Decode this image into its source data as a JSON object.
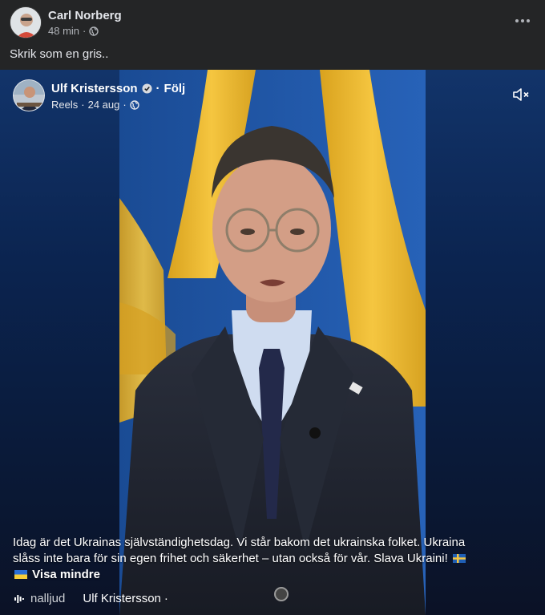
{
  "post": {
    "author": "Carl Norberg",
    "time": "48 min",
    "separator": "·",
    "text": "Skrik som en gris.."
  },
  "reel": {
    "author": "Ulf Kristersson",
    "follow_sep": "·",
    "follow_label": "Följ",
    "meta_type": "Reels",
    "meta_sep": "·",
    "meta_date": "24 aug",
    "meta_sep2": "·",
    "caption_line1": "Idag är det Ukrainas självständighetsdag. Vi står bakom det ukrainska folket. Ukraina",
    "caption_line2": "slåss inte bara för sin egen frihet och säkerhet – utan också för vår. Slava Ukraini!",
    "show_less_label": "Visa mindre",
    "audio_label": "nalljud",
    "audio_artist": "Ulf Kristersson",
    "audio_sep": "·"
  },
  "icons": {
    "more": "more-horizontal-icon",
    "globe": "globe-icon",
    "verified": "verified-badge-icon",
    "mute": "speaker-muted-icon",
    "audio": "audio-bars-icon",
    "flag_se": "sweden-flag-icon",
    "flag_ua": "ukraine-flag-icon"
  },
  "colors": {
    "background": "#242526",
    "text_primary": "#e4e6eb",
    "text_secondary": "#b0b3b8",
    "reel_blue": "#0b2450",
    "flag_yellow": "#f2c12e"
  }
}
